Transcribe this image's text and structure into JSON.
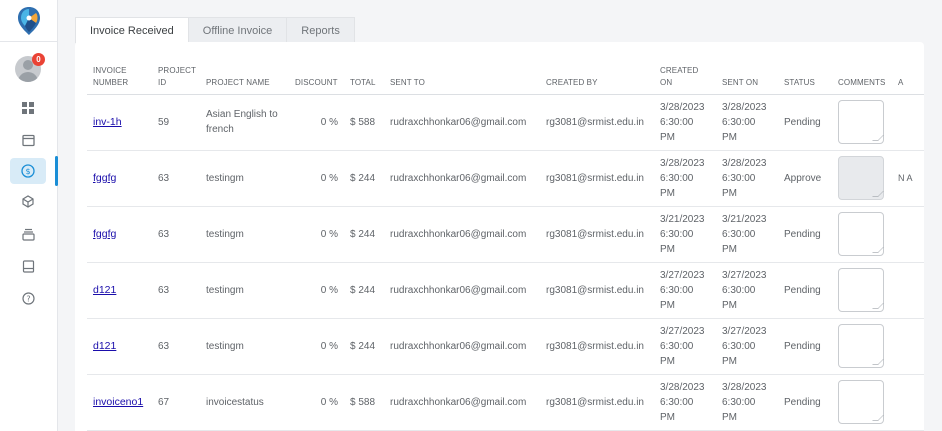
{
  "sidebar": {
    "notification_count": "0",
    "items": [
      {
        "icon": "dashboard-icon",
        "active": false
      },
      {
        "icon": "calendar-icon",
        "active": false
      },
      {
        "icon": "dollar-icon",
        "active": true
      },
      {
        "icon": "box-icon",
        "active": false
      },
      {
        "icon": "archive-icon",
        "active": false
      },
      {
        "icon": "document-icon",
        "active": false
      },
      {
        "icon": "help-icon",
        "active": false
      }
    ]
  },
  "tabs": [
    {
      "label": "Invoice Received",
      "active": true
    },
    {
      "label": "Offline Invoice",
      "active": false
    },
    {
      "label": "Reports",
      "active": false
    }
  ],
  "table": {
    "headers": {
      "invoice_number": "INVOICE NUMBER",
      "project_id": "PROJECT ID",
      "project_name": "PROJECT NAME",
      "discount": "DISCOUNT",
      "total": "TOTAL",
      "sent_to": "SENT TO",
      "created_by": "CREATED BY",
      "created_on": "CREATED ON",
      "sent_on": "SENT ON",
      "status": "STATUS",
      "comments": "COMMENTS",
      "extra": "A"
    },
    "rows": [
      {
        "invoice_number": "inv-1h",
        "project_id": "59",
        "project_name": "Asian English to french",
        "discount": "0 %",
        "total": "$ 588",
        "sent_to": "rudraxchhonkar06@gmail.com",
        "created_by": "rg3081@srmist.edu.in",
        "created_on": "3/28/2023 6:30:00 PM",
        "sent_on": "3/28/2023 6:30:00 PM",
        "status": "Pending",
        "comment_disabled": false,
        "extra": ""
      },
      {
        "invoice_number": "fggfg",
        "project_id": "63",
        "project_name": "testingm",
        "discount": "0 %",
        "total": "$ 244",
        "sent_to": "rudraxchhonkar06@gmail.com",
        "created_by": "rg3081@srmist.edu.in",
        "created_on": "3/28/2023 6:30:00 PM",
        "sent_on": "3/28/2023 6:30:00 PM",
        "status": "Approve",
        "comment_disabled": true,
        "extra": "N A"
      },
      {
        "invoice_number": "fggfg",
        "project_id": "63",
        "project_name": "testingm",
        "discount": "0 %",
        "total": "$ 244",
        "sent_to": "rudraxchhonkar06@gmail.com",
        "created_by": "rg3081@srmist.edu.in",
        "created_on": "3/21/2023 6:30:00 PM",
        "sent_on": "3/21/2023 6:30:00 PM",
        "status": "Pending",
        "comment_disabled": false,
        "extra": ""
      },
      {
        "invoice_number": "d121",
        "project_id": "63",
        "project_name": "testingm",
        "discount": "0 %",
        "total": "$ 244",
        "sent_to": "rudraxchhonkar06@gmail.com",
        "created_by": "rg3081@srmist.edu.in",
        "created_on": "3/27/2023 6:30:00 PM",
        "sent_on": "3/27/2023 6:30:00 PM",
        "status": "Pending",
        "comment_disabled": false,
        "extra": ""
      },
      {
        "invoice_number": "d121",
        "project_id": "63",
        "project_name": "testingm",
        "discount": "0 %",
        "total": "$ 244",
        "sent_to": "rudraxchhonkar06@gmail.com",
        "created_by": "rg3081@srmist.edu.in",
        "created_on": "3/27/2023 6:30:00 PM",
        "sent_on": "3/27/2023 6:30:00 PM",
        "status": "Pending",
        "comment_disabled": false,
        "extra": ""
      },
      {
        "invoice_number": "invoiceno1",
        "project_id": "67",
        "project_name": "invoicestatus",
        "discount": "0 %",
        "total": "$ 588",
        "sent_to": "rudraxchhonkar06@gmail.com",
        "created_by": "rg3081@srmist.edu.in",
        "created_on": "3/28/2023 6:30:00 PM",
        "sent_on": "3/28/2023 6:30:00 PM",
        "status": "Pending",
        "comment_disabled": false,
        "extra": ""
      }
    ]
  },
  "colors": {
    "accent": "#1a8ed6",
    "active_nav_bg": "#d8ebf7",
    "link": "#1a0dab",
    "badge": "#ea4335"
  }
}
